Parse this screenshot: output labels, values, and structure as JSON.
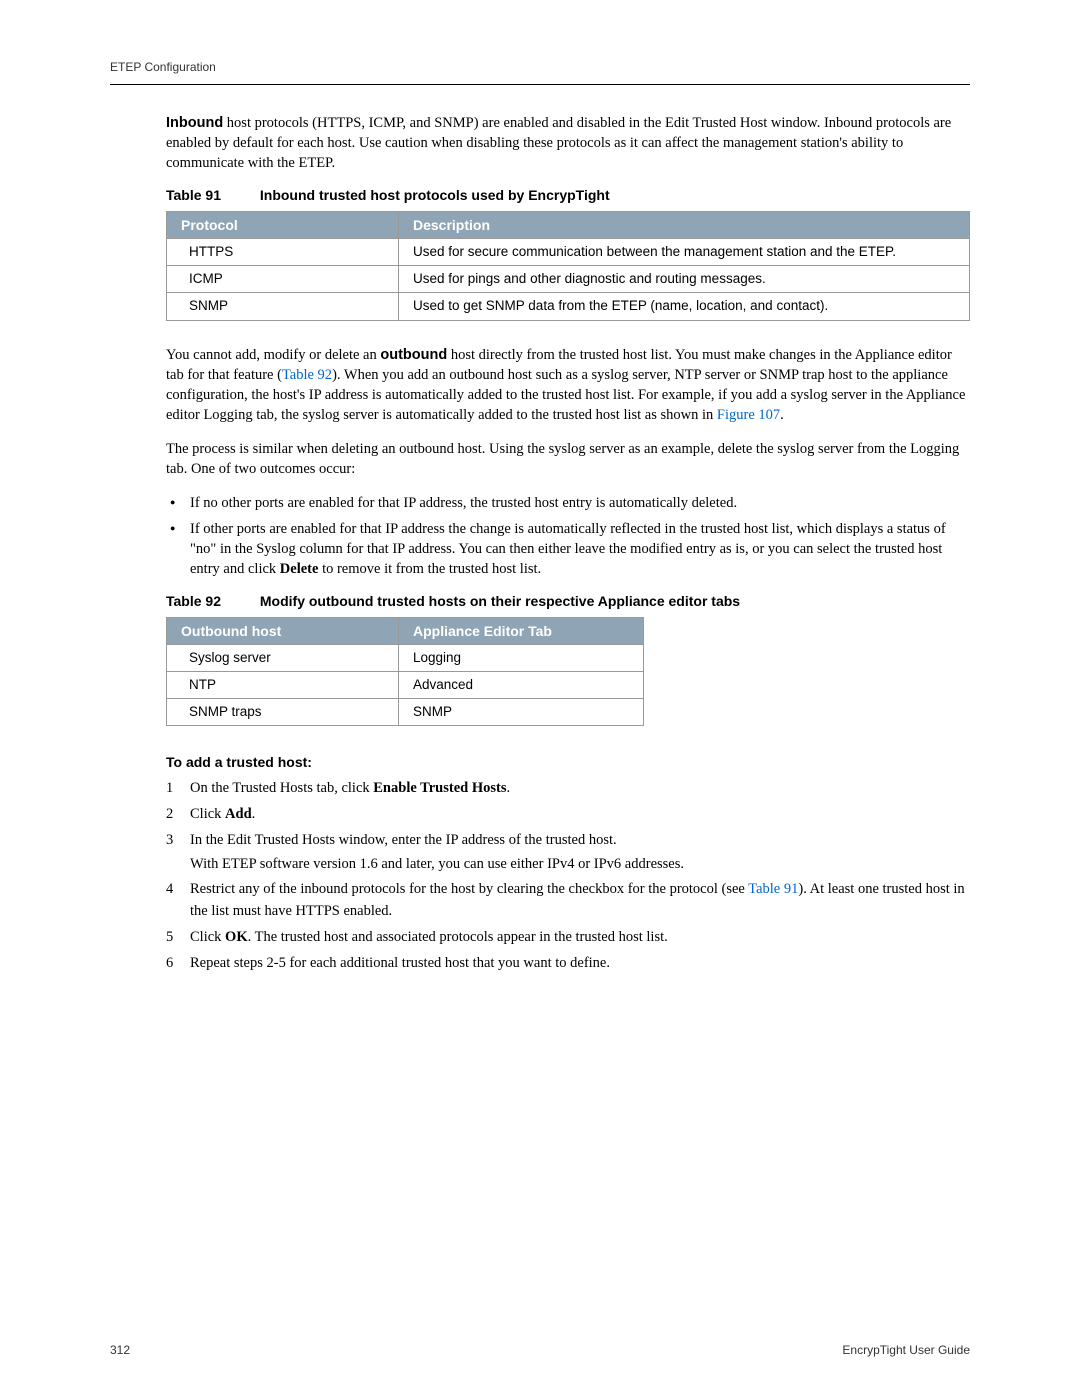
{
  "header": {
    "title": "ETEP Configuration"
  },
  "intro": {
    "inbound_label": "Inbound",
    "text": " host protocols (HTTPS, ICMP, and SNMP) are enabled and disabled in the Edit Trusted Host window. Inbound protocols are enabled by default for each host. Use caution when disabling these protocols as it can affect the management station's ability to communicate with the ETEP."
  },
  "table91": {
    "label": "Table 91",
    "title": "Inbound trusted host protocols used by EncrypTight",
    "headers": [
      "Protocol",
      "Description"
    ],
    "rows": [
      [
        "HTTPS",
        "Used for secure communication between the management station and the ETEP."
      ],
      [
        "ICMP",
        "Used for pings and other diagnostic and routing messages."
      ],
      [
        "SNMP",
        "Used to get SNMP data from the ETEP (name, location, and contact)."
      ]
    ]
  },
  "para2": {
    "pre": "You cannot add, modify or delete an ",
    "outbound_label": "outbound",
    "mid1": " host directly from the trusted host list. You must make changes in the Appliance editor tab for that feature (",
    "link1": "Table 92",
    "mid2": "). When you add an outbound host such as a syslog server, NTP server or SNMP trap host to the appliance configuration, the host's IP address is automatically added to the trusted host list. For example, if you add a syslog server in the Appliance editor Logging tab, the syslog server is automatically added to the trusted host list as shown in ",
    "link2": "Figure 107",
    "post": "."
  },
  "para3": "The process is similar when deleting an outbound host. Using the syslog server as an example, delete the syslog server from the Logging tab. One of two outcomes occur:",
  "bullets": [
    {
      "text": "If no other ports are enabled for that IP address, the trusted host entry is automatically deleted."
    },
    {
      "pre": "If other ports are enabled for that IP address the change is automatically reflected in the trusted host list, which displays a status of \"no\" in the Syslog column for that IP address. You can then either leave the modified entry as is, or you can select the trusted host entry and click ",
      "bold": "Delete",
      "post": " to remove it from the trusted host list."
    }
  ],
  "table92": {
    "label": "Table 92",
    "title": "Modify outbound trusted hosts on their respective Appliance editor tabs",
    "headers": [
      "Outbound host",
      "Appliance Editor Tab"
    ],
    "rows": [
      [
        "Syslog server",
        "Logging"
      ],
      [
        "NTP",
        "Advanced"
      ],
      [
        "SNMP traps",
        "SNMP"
      ]
    ]
  },
  "procedure": {
    "title": "To add a trusted host:",
    "steps": {
      "s1": {
        "pre": "On the Trusted Hosts tab, click ",
        "bold": "Enable Trusted Hosts",
        "post": "."
      },
      "s2": {
        "pre": "Click ",
        "bold": "Add",
        "post": "."
      },
      "s3": {
        "line1": "In the Edit Trusted Hosts window, enter the IP address of the trusted host.",
        "line2": "With ETEP software version 1.6 and later, you can use either IPv4 or IPv6 addresses."
      },
      "s4": {
        "pre": "Restrict any of the inbound protocols for the host by clearing the checkbox for the protocol (see ",
        "link": "Table 91",
        "post": "). At least one trusted host in the list must have HTTPS enabled."
      },
      "s5": {
        "pre": "Click ",
        "bold": "OK",
        "post": ". The trusted host and associated protocols appear in the trusted host list."
      },
      "s6": {
        "text": "Repeat steps 2-5 for each additional trusted host that you want to define."
      }
    }
  },
  "footer": {
    "page": "312",
    "guide": "EncrypTight User Guide"
  }
}
